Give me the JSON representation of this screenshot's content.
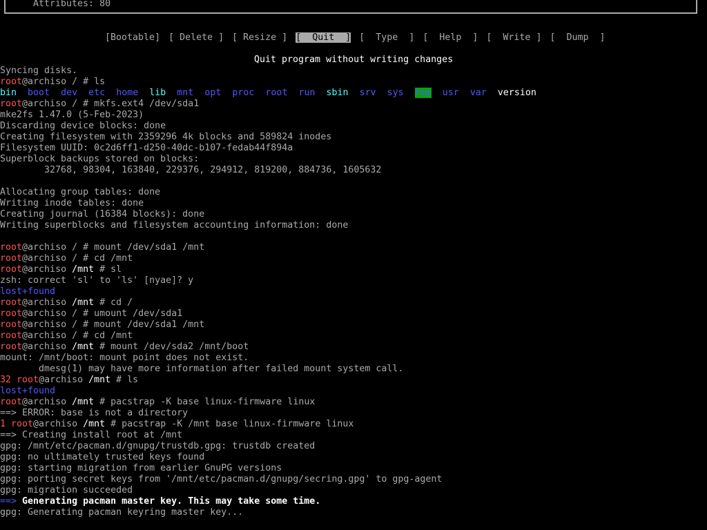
{
  "top": {
    "attributes_line": "Attributes: 80"
  },
  "menu": {
    "items": [
      "[Bootable]",
      "[ Delete ]",
      "[ Resize ]",
      "[  Quit  ]",
      "[  Type  ]",
      "[  Help  ]",
      "[  Write ]",
      "[  Dump  ]"
    ],
    "selected": "[  Quit  ]"
  },
  "hint": "Quit program without writing changes",
  "terminal": {
    "prompt_user": "root",
    "prompt_host": "@archiso",
    "lines": [
      "Syncing disks.",
      "root@archiso / # ls",
      "LS_LISTING",
      "root@archiso / # mkfs.ext4 /dev/sda1",
      "mke2fs 1.47.0 (5-Feb-2023)",
      "Discarding device blocks: done",
      "Creating filesystem with 2359296 4k blocks and 589824 inodes",
      "Filesystem UUID: 0c2d6ff1-d250-40dc-b107-fedab44f894a",
      "Superblock backups stored on blocks:",
      "        32768, 98304, 163840, 229376, 294912, 819200, 884736, 1605632",
      "",
      "Allocating group tables: done",
      "Writing inode tables: done",
      "Creating journal (16384 blocks): done",
      "Writing superblocks and filesystem accounting information: done",
      "",
      "root@archiso / # mount /dev/sda1 /mnt",
      "root@archiso / # cd /mnt",
      "root@archiso /mnt # sl",
      "zsh: correct 'sl' to 'ls' [nyae]? y",
      "lost+found",
      "root@archiso /mnt # cd /",
      "root@archiso / # umount /dev/sda1",
      "root@archiso / # mount /dev/sda1 /mnt",
      "root@archiso / # cd /mnt",
      "root@archiso /mnt # mount /dev/sda2 /mnt/boot",
      "mount: /mnt/boot: mount point does not exist.",
      "       dmesg(1) may have more information after failed mount system call.",
      "32 root@archiso /mnt # ls",
      "lost+found",
      "root@archiso /mnt # pacstrap -K base linux-firmware linux",
      "==> ERROR: base is not a directory",
      "1 root@archiso /mnt # pacstrap -K /mnt base linux-firmware linux",
      "==> Creating install root at /mnt",
      "gpg: /mnt/etc/pacman.d/gnupg/trustdb.gpg: trustdb created",
      "gpg: no ultimately trusted keys found",
      "gpg: starting migration from earlier GnuPG versions",
      "gpg: porting secret keys from '/mnt/etc/pacman.d/gnupg/secring.gpg' to gpg-agent",
      "gpg: migration succeeded",
      "==> Generating pacman master key. This may take some time.",
      "gpg: Generating pacman keyring master key..."
    ],
    "ls_listing": [
      "bin",
      "boot",
      "dev",
      "etc",
      "home",
      "lib",
      "mnt",
      "opt",
      "proc",
      "root",
      "run",
      "sbin",
      "srv",
      "sys",
      "tmp",
      "usr",
      "var",
      "version"
    ]
  },
  "colors": {
    "prompt_user": "#ff5555",
    "directory": "#5555ff",
    "symlink": "#55ffff",
    "text": "#aaaaaa",
    "highlight": "#ffffff"
  }
}
